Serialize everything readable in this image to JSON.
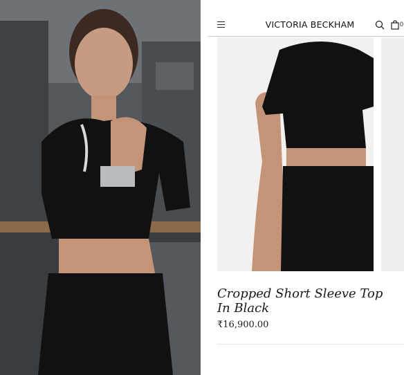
{
  "header": {
    "brand": "VICTORIA BECKHAM",
    "bag_count": "0",
    "icons": [
      "menu-icon",
      "search-icon",
      "bag-icon"
    ]
  },
  "product": {
    "title": "Cropped Short Sleeve Top In Black",
    "price": "₹16,900.00"
  },
  "colors": {
    "garment": "#111111",
    "photo_background": "#4b4d50",
    "product_image_background": "#f2f1f0",
    "divider": "#e4e4e4"
  }
}
